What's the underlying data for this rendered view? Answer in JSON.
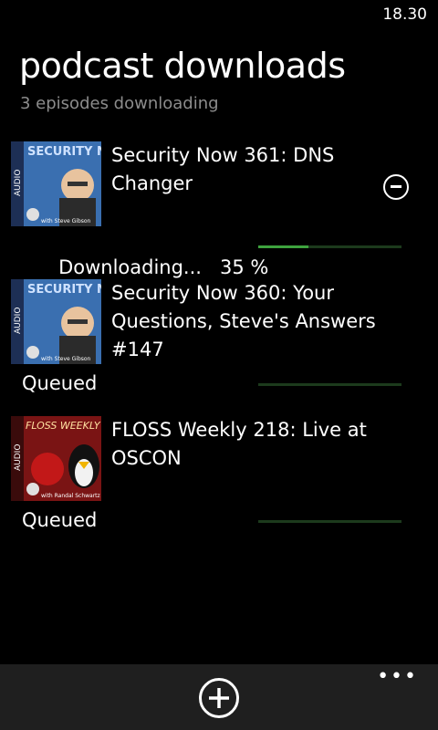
{
  "status_bar": {
    "time": "18.30"
  },
  "header": {
    "title": "podcast downloads",
    "subtitle": "3 episodes downloading"
  },
  "episodes": [
    {
      "title": "Security Now 361: DNS Changer",
      "artwork": "security-now-artwork",
      "artwork_text": {
        "show": "SECURITY NOW",
        "host": "with Steve Gibson",
        "badge": "AUDIO"
      },
      "status": "Downloading...",
      "progress_label": "35 %",
      "progress": 0.35,
      "removable": true
    },
    {
      "title": "Security Now 360: Your Questions, Steve's Answers #147",
      "artwork": "security-now-artwork",
      "artwork_text": {
        "show": "SECURITY NOW",
        "host": "with Steve Gibson",
        "badge": "AUDIO"
      },
      "status": "Queued",
      "progress": 0
    },
    {
      "title": "FLOSS Weekly 218: Live at OSCON",
      "artwork": "floss-weekly-artwork",
      "artwork_text": {
        "show": "FLOSS WEEKLY",
        "host": "with Randal Schwartz",
        "badge": "AUDIO"
      },
      "status": "Queued",
      "progress": 0
    }
  ],
  "colors": {
    "accent": "#3ea33e",
    "track": "#1c3a1c",
    "appbar": "#1f1f1f",
    "subtitle": "#8c8c8c"
  },
  "app_bar": {
    "add_icon": "plus-circle-icon",
    "more_icon": "ellipsis-icon"
  }
}
